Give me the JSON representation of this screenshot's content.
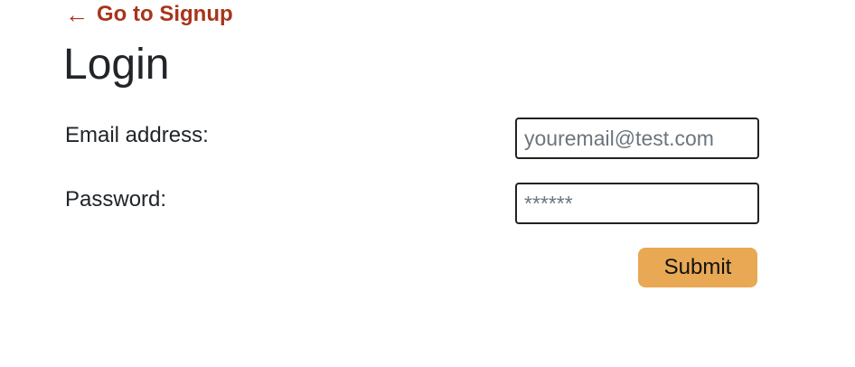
{
  "nav": {
    "back_arrow": "←",
    "back_label": "Go to Signup",
    "back_icon": "left-arrow-icon",
    "link_color": "#a8341a"
  },
  "page": {
    "title": "Login"
  },
  "form": {
    "email_label": "Email address:",
    "email_placeholder": "youremail@test.com",
    "email_value": "",
    "password_label": "Password:",
    "password_placeholder": "******",
    "password_value": "",
    "submit_label": "Submit",
    "submit_color": "#e8a854"
  }
}
